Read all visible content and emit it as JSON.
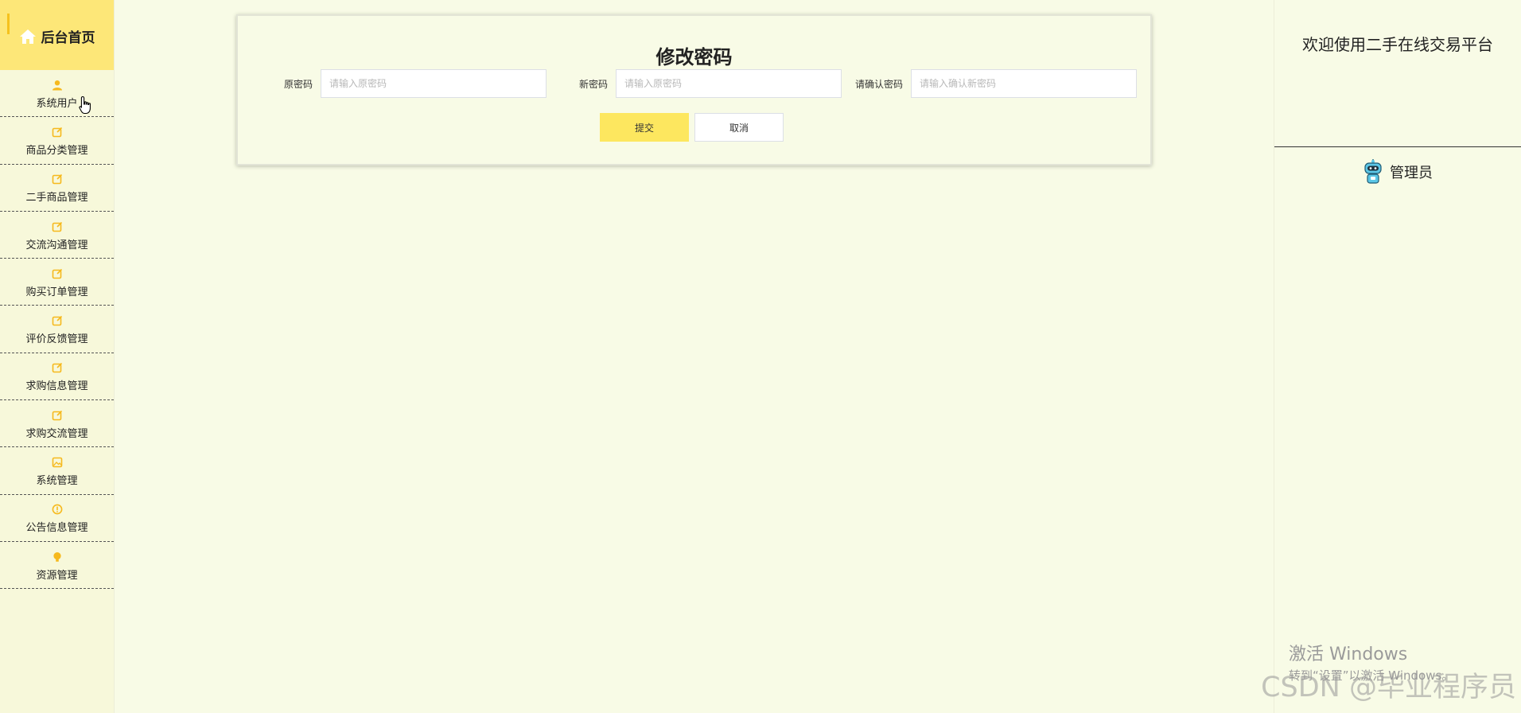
{
  "sidebar": {
    "home_label": "后台首页",
    "items": [
      {
        "label": "系统用户",
        "icon": "user-icon"
      },
      {
        "label": "商品分类管理",
        "icon": "edit-icon"
      },
      {
        "label": "二手商品管理",
        "icon": "edit-icon"
      },
      {
        "label": "交流沟通管理",
        "icon": "edit-icon"
      },
      {
        "label": "购买订单管理",
        "icon": "edit-icon"
      },
      {
        "label": "评价反馈管理",
        "icon": "edit-icon"
      },
      {
        "label": "求购信息管理",
        "icon": "edit-icon"
      },
      {
        "label": "求购交流管理",
        "icon": "edit-icon"
      },
      {
        "label": "系统管理",
        "icon": "image-icon"
      },
      {
        "label": "公告信息管理",
        "icon": "info-icon"
      },
      {
        "label": "资源管理",
        "icon": "bulb-icon"
      }
    ]
  },
  "form": {
    "title": "修改密码",
    "fields": [
      {
        "label": "原密码",
        "placeholder": "请输入原密码"
      },
      {
        "label": "新密码",
        "placeholder": "请输入原密码"
      },
      {
        "label": "请确认密码",
        "placeholder": "请输入确认新密码"
      }
    ],
    "submit_label": "提交",
    "cancel_label": "取消"
  },
  "right": {
    "welcome": "欢迎使用二手在线交易平台",
    "user_name": "管理员"
  },
  "overlay": {
    "windows_title": "激活 Windows",
    "windows_sub": "转到“设置”以激活 Windows。",
    "csdn": "CSDN @毕业程序员"
  },
  "colors": {
    "accent": "#fde778",
    "icon": "#f6b91d",
    "background": "#f8fbe6"
  }
}
